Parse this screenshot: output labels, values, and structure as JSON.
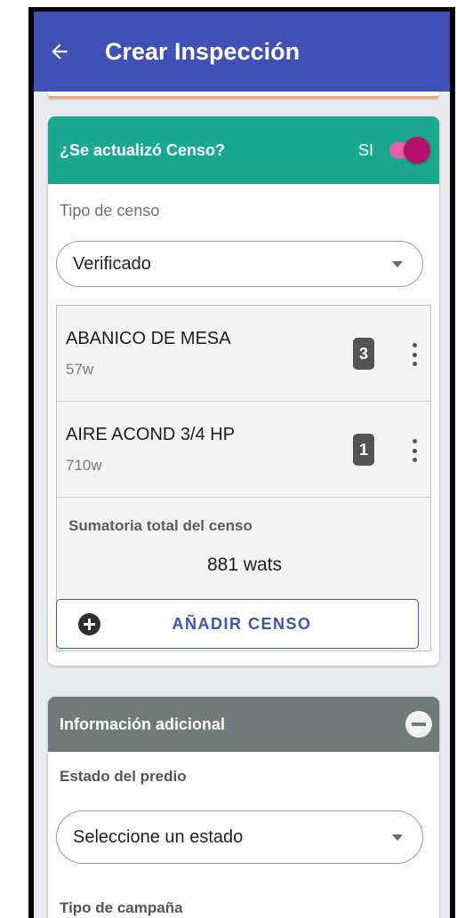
{
  "appbar": {
    "title": "Crear Inspección",
    "back_icon": "arrow-back-icon"
  },
  "censo": {
    "question": "¿Se actualizó Censo?",
    "toggle_label": "SI",
    "toggle_on": true,
    "tipo_label": "Tipo de censo",
    "tipo_value": "Verificado",
    "items": [
      {
        "name": "ABANICO DE MESA",
        "watts": "57w",
        "count": "3"
      },
      {
        "name": "AIRE ACOND 3/4 HP",
        "watts": "710w",
        "count": "1"
      }
    ],
    "sum_label": "Sumatoria total del censo",
    "sum_value": "881 wats",
    "add_button": "AÑADIR CENSO"
  },
  "info": {
    "title": "Información adicional",
    "estado_label": "Estado del predio",
    "estado_value": "Seleccione un estado",
    "campana_label": "Tipo de campaña"
  },
  "colors": {
    "appbar": "#3f51b5",
    "censo_header": "#1aa88f",
    "info_header": "#6f7b79",
    "toggle": "#b5106e"
  }
}
